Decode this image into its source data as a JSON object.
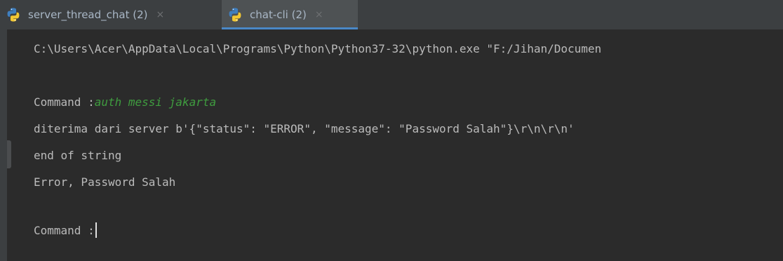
{
  "tabs": [
    {
      "label": "server_thread_chat (2)",
      "close": "×",
      "active": false,
      "icon": "python-icon"
    },
    {
      "label": "chat-cli (2)",
      "close": "×",
      "active": true,
      "icon": "python-icon"
    }
  ],
  "console": {
    "command_line": "C:\\Users\\Acer\\AppData\\Local\\Programs\\Python\\Python37-32\\python.exe \"F:/Jihan/Documen",
    "prompt1": "Command :",
    "input1": "auth messi jakarta",
    "response": "diterima dari server b'{\"status\": \"ERROR\", \"message\": \"Password Salah\"}\\r\\n\\r\\n'",
    "end_of_string": "end of string",
    "error": "Error, Password Salah",
    "prompt2": "Command :"
  },
  "colors": {
    "background": "#2b2b2b",
    "text": "#bbbbbb",
    "user_input": "#3f9c3f",
    "active_tab_underline": "#4a88c7"
  }
}
